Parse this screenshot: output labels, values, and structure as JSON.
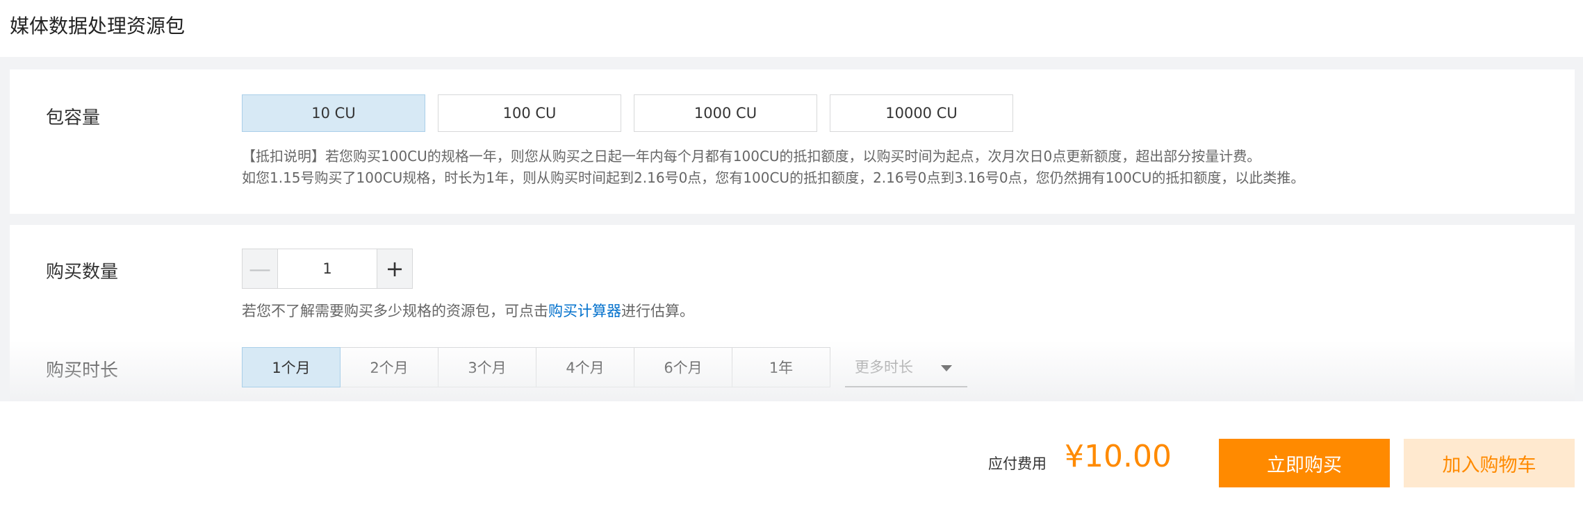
{
  "page": {
    "title": "媒体数据处理资源包"
  },
  "capacity": {
    "label": "包容量",
    "options": [
      "10 CU",
      "100 CU",
      "1000 CU",
      "10000 CU"
    ],
    "selected": "10 CU",
    "desc_line1": "【抵扣说明】若您购买100CU的规格一年，则您从购买之日起一年内每个月都有100CU的抵扣额度，以购买时间为起点，次月次日0点更新额度，超出部分按量计费。",
    "desc_line2": "如您1.15号购买了100CU规格，时长为1年，则从购买时间起到2.16号0点，您有100CU的抵扣额度，2.16号0点到3.16号0点，您仍然拥有100CU的抵扣额度，以此类推。"
  },
  "quantity": {
    "label": "购买数量",
    "value": "1",
    "minus": "—",
    "plus": "+",
    "hint_prefix": "若您不了解需要购买多少规格的资源包，可点击",
    "hint_link": "购买计算器",
    "hint_suffix": "进行估算。"
  },
  "duration": {
    "label": "购买时长",
    "options": [
      "1个月",
      "2个月",
      "3个月",
      "4个月",
      "6个月",
      "1年"
    ],
    "selected": "1个月",
    "more_placeholder": "更多时长"
  },
  "footer": {
    "fee_label": "应付费用",
    "fee_amount": "¥10.00",
    "buy_now": "立即购买",
    "add_to_cart": "加入购物车"
  },
  "colors": {
    "accent": "#ff8a00",
    "selected_bg": "#d7e9f5",
    "link": "#0070cc"
  }
}
